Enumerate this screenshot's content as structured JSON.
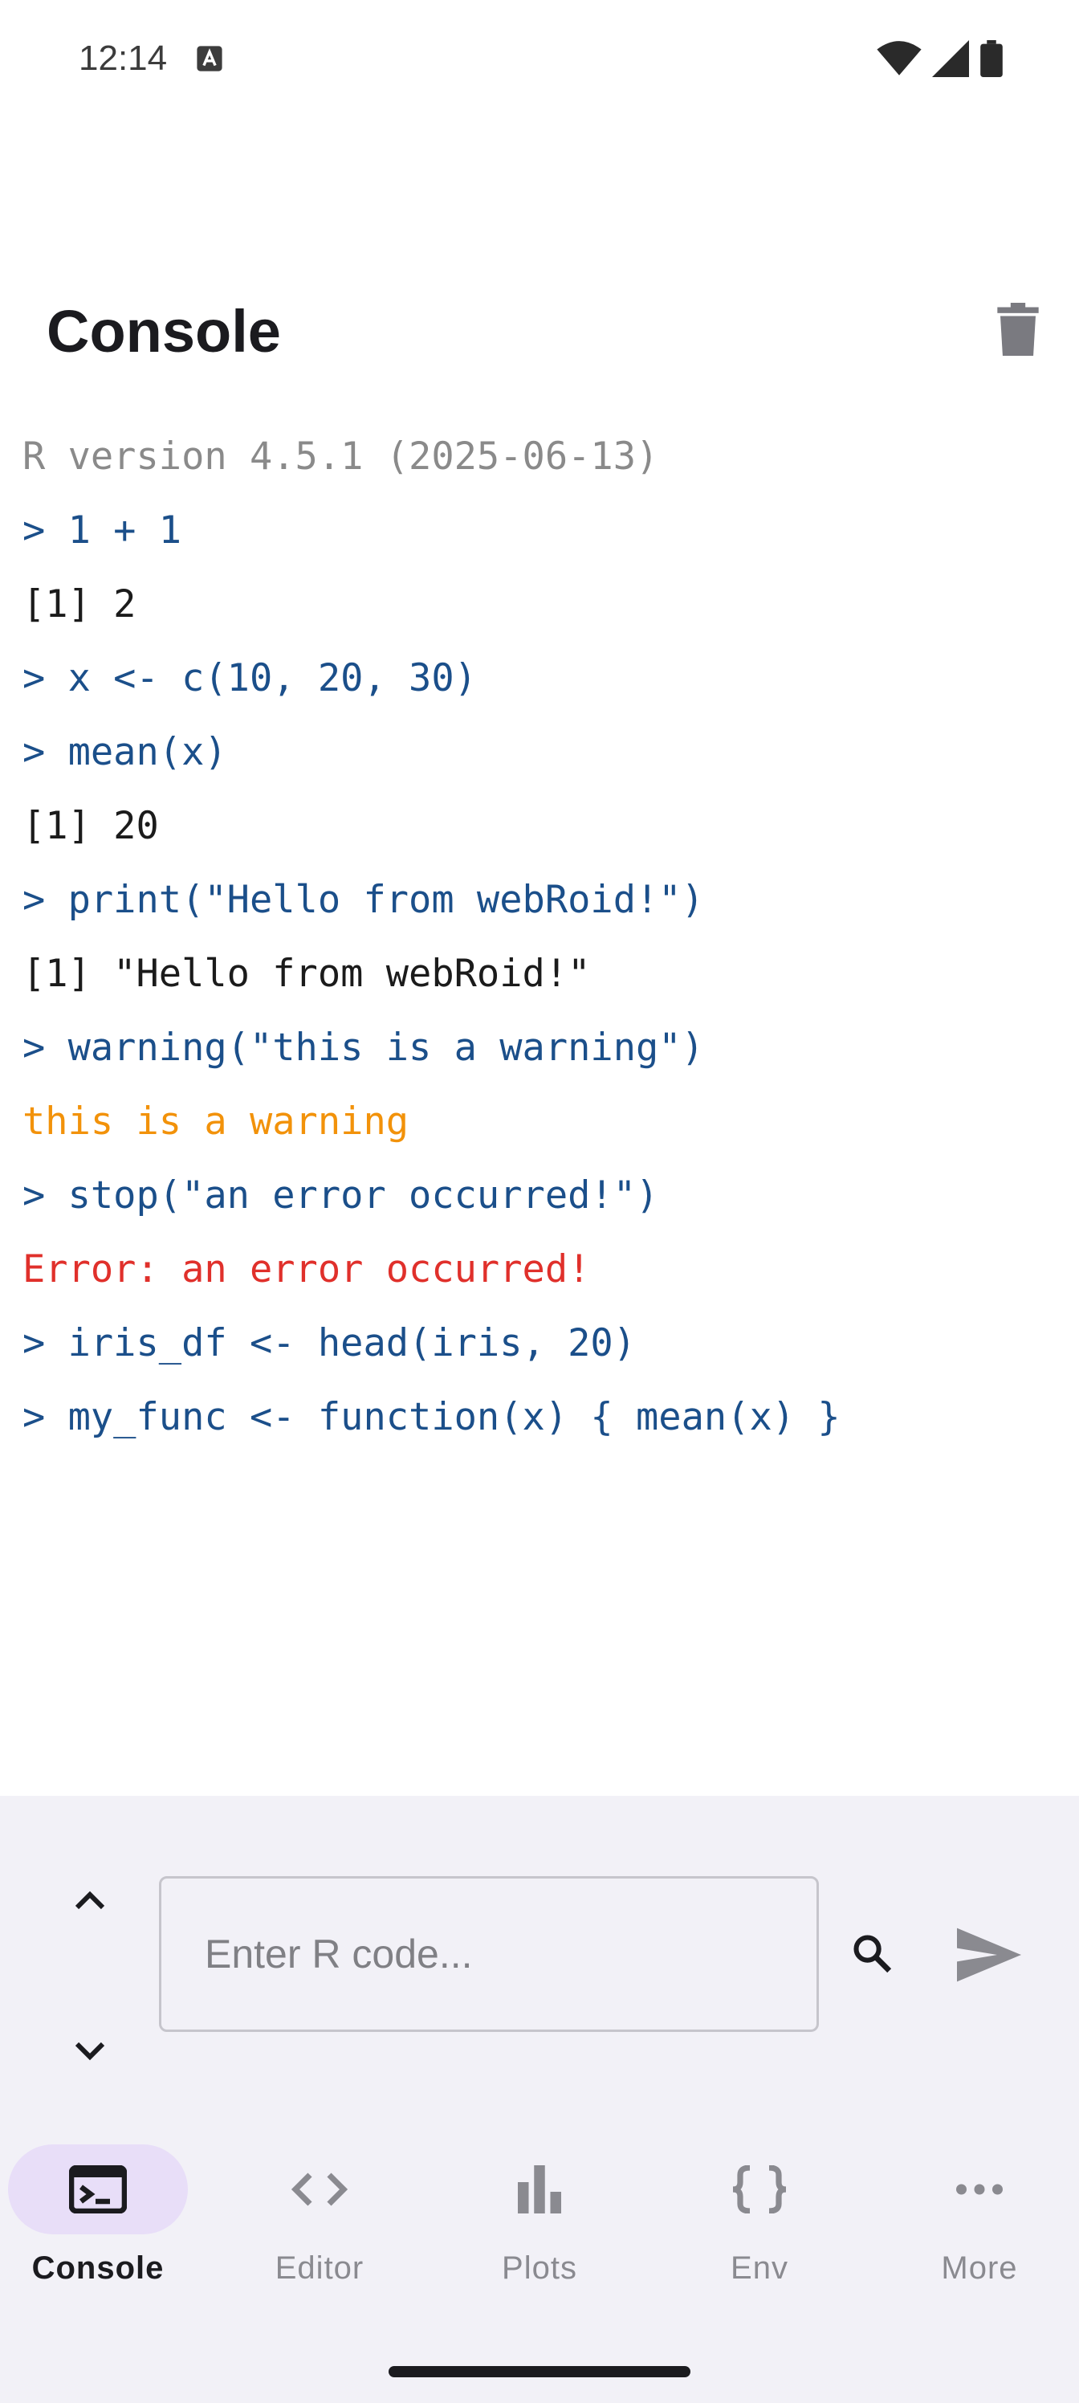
{
  "status_bar": {
    "time": "12:14",
    "icons": [
      "a-notification-icon",
      "wifi-icon",
      "signal-icon",
      "battery-icon"
    ]
  },
  "header": {
    "title": "Console",
    "clear_icon": "trash-icon"
  },
  "console": {
    "lines": [
      {
        "type": "info",
        "text": "R version 4.5.1 (2025-06-13)"
      },
      {
        "type": "input",
        "text": "> 1 + 1"
      },
      {
        "type": "output",
        "text": "[1] 2"
      },
      {
        "type": "input",
        "text": "> x <- c(10, 20, 30)"
      },
      {
        "type": "input",
        "text": "> mean(x)"
      },
      {
        "type": "output",
        "text": "[1] 20"
      },
      {
        "type": "input",
        "text": "> print(\"Hello from webRoid!\")"
      },
      {
        "type": "output",
        "text": "[1] \"Hello from webRoid!\""
      },
      {
        "type": "input",
        "text": "> warning(\"this is a warning\")"
      },
      {
        "type": "warning",
        "text": "this is a warning"
      },
      {
        "type": "input",
        "text": "> stop(\"an error occurred!\")"
      },
      {
        "type": "error",
        "text": "Error: an error occurred!"
      },
      {
        "type": "input",
        "text": "> iris_df <- head(iris, 20)"
      },
      {
        "type": "input",
        "text": "> my_func <- function(x) { mean(x) }"
      }
    ]
  },
  "input_bar": {
    "placeholder": "Enter R code...",
    "value": "",
    "icons": [
      "chevron-up-icon",
      "chevron-down-icon",
      "search-icon",
      "send-icon"
    ]
  },
  "bottom_nav": {
    "items": [
      {
        "label": "Console",
        "icon": "terminal-icon",
        "active": true
      },
      {
        "label": "Editor",
        "icon": "code-icon",
        "active": false
      },
      {
        "label": "Plots",
        "icon": "bar-chart-icon",
        "active": false
      },
      {
        "label": "Env",
        "icon": "braces-icon",
        "active": false
      },
      {
        "label": "More",
        "icon": "more-horiz-icon",
        "active": false
      }
    ]
  },
  "colors": {
    "input": "#1b4f8a",
    "output": "#1b1b1b",
    "info": "#8a8a8a",
    "warning": "#f2920a",
    "error": "#e0302b",
    "nav_active_pill": "#e8def8",
    "panel_bg": "#f2f1f7"
  }
}
